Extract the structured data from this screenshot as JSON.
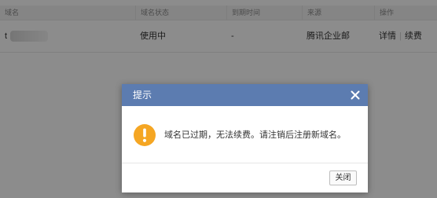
{
  "table": {
    "headers": [
      "域名",
      "域名状态",
      "到期时间",
      "来源",
      "操作"
    ],
    "row": {
      "domain_prefix": "t",
      "status": "使用中",
      "expiry": "-",
      "source": "腾讯企业邮",
      "action_details": "详情",
      "action_separator": "|",
      "action_renew": "续费"
    }
  },
  "dialog": {
    "title": "提示",
    "message": "域名已过期，无法续费。请注销后注册新域名。",
    "close_button": "关闭",
    "header_color": "#5c7cb0",
    "warning_color": "#f5a623"
  },
  "icons": {
    "close": "close-icon",
    "warning": "warning-icon"
  }
}
